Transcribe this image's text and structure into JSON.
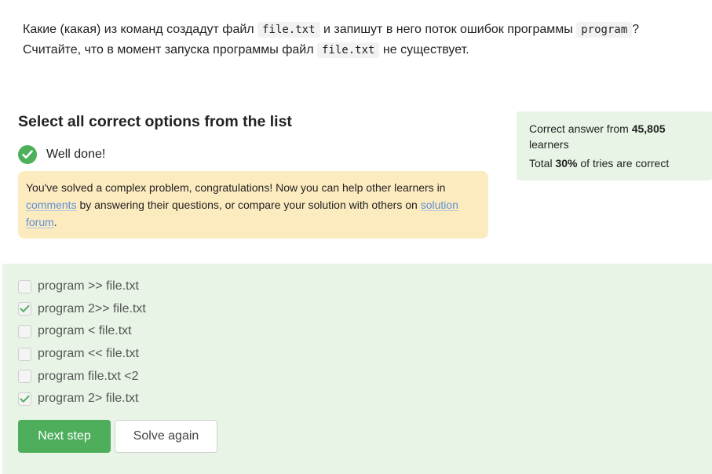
{
  "question": {
    "line1_a": "Какие (какая) из команд создадут файл",
    "code1": "file.txt",
    "line1_b": "и запишут в него поток ошибок программы",
    "code2": "program",
    "line1_c": "?",
    "line2_a": "Считайте, что в момент запуска программы файл",
    "code3": "file.txt",
    "line2_b": "не существует."
  },
  "task": {
    "heading": "Select all correct options from the list",
    "status_label": "Well done!",
    "status_icon": "check-circle-icon",
    "status_color": "#4fb05c"
  },
  "notice": {
    "text_a": "You've solved a complex problem, congratulations! Now you can help other learners in",
    "link_comments": "comments",
    "text_b": "by answering their questions, or compare your solution with others on",
    "link_forum": "solution forum",
    "text_c": "."
  },
  "stats": {
    "prefix": "Correct answer from",
    "learners_count": "45,805",
    "learners_word": "learners",
    "total_prefix": "Total",
    "percent": "30%",
    "total_suffix": "of tries are correct"
  },
  "options": [
    {
      "label": "program >> file.txt",
      "checked": false
    },
    {
      "label": "program 2>> file.txt",
      "checked": true
    },
    {
      "label": "program < file.txt",
      "checked": false
    },
    {
      "label": "program << file.txt",
      "checked": false
    },
    {
      "label": "program file.txt <2",
      "checked": false
    },
    {
      "label": "program 2> file.txt",
      "checked": true
    }
  ],
  "buttons": {
    "next": "Next step",
    "solve_again": "Solve again"
  },
  "colors": {
    "accent": "#4fae5c",
    "answers_bg": "#e8f5e6",
    "notice_bg": "#fdebc0",
    "link": "#5b8fd4"
  }
}
